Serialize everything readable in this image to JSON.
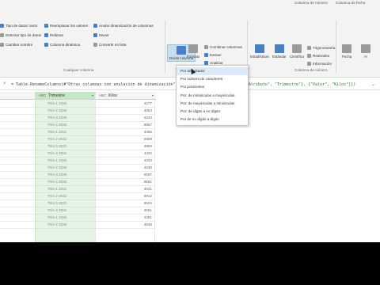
{
  "ribbon": {
    "group_titles": [
      "Columna de número",
      "Columna de fecha"
    ],
    "left_items": [
      {
        "label": "Tipo de datos: texto",
        "icon": "data-type-icon"
      },
      {
        "label": "Detectar tipo de datos",
        "icon": "detect-type-icon"
      },
      {
        "label": "Cambiar nombre",
        "icon": "rename-icon"
      }
    ],
    "mid_items": [
      {
        "label": "Reemplazar los valores",
        "icon": "replace-values-icon"
      },
      {
        "label": "Rellenar",
        "icon": "fill-icon"
      },
      {
        "label": "Columna dinámica",
        "icon": "pivot-column-icon"
      }
    ],
    "right_items": [
      {
        "label": "Anular dinamización de columnas",
        "icon": "unpivot-icon"
      },
      {
        "label": "Mover",
        "icon": "move-icon"
      },
      {
        "label": "Convertir en lista",
        "icon": "convert-list-icon"
      }
    ],
    "big_buttons": [
      {
        "label": "Dividir columna",
        "icon": "split-column-icon"
      },
      {
        "label": "Formato",
        "icon": "format-icon"
      }
    ],
    "text_col_items": [
      {
        "label": "Combinar columnas",
        "icon": "merge-columns-icon"
      },
      {
        "label": "Extraer",
        "icon": "extract-icon"
      },
      {
        "label": "Analizar",
        "icon": "parse-icon"
      }
    ],
    "num_buttons": [
      {
        "label": "Estadísticas",
        "icon": "statistics-icon"
      },
      {
        "label": "Estándar",
        "icon": "standard-icon"
      },
      {
        "label": "Científico",
        "icon": "scientific-icon"
      }
    ],
    "trig_items": [
      {
        "label": "Trigonometría",
        "icon": "trig-icon"
      },
      {
        "label": "Redondeo",
        "icon": "rounding-icon"
      },
      {
        "label": "Información",
        "icon": "info-icon"
      }
    ],
    "date_buttons": [
      {
        "label": "Fecha",
        "icon": "date-icon"
      },
      {
        "label": "H",
        "icon": "time-icon"
      }
    ],
    "group_labels": {
      "any_column": "Cualquier columna",
      "number_column": "Columna de número"
    }
  },
  "formula": {
    "prefix": "= Table.RenameColumns(#\"Otras columnas con anulación de dinamización\",",
    "suffix": "\"Atributo\", \"Trimestre\"}, {\"Valor\", \"Kilos\"}})"
  },
  "table": {
    "columns": [
      {
        "type": "ABC",
        "name": "Trimestre"
      },
      {
        "type": "ABC",
        "name": "Kilos"
      }
    ],
    "rows": [
      {
        "trimestre": "Trim 1 2020",
        "kilos": "4277"
      },
      {
        "trimestre": "Trim 2 2020",
        "kilos": "3054"
      },
      {
        "trimestre": "Trim 3 2020",
        "kilos": "4234"
      },
      {
        "trimestre": "Trim 4 2020",
        "kilos": "6067"
      },
      {
        "trimestre": "Trim 1 2021",
        "kilos": "4466"
      },
      {
        "trimestre": "Trim 2 2021",
        "kilos": "2809"
      },
      {
        "trimestre": "Trim 3 2021",
        "kilos": "4853"
      },
      {
        "trimestre": "Trim 4 2021",
        "kilos": "4432"
      },
      {
        "trimestre": "Trim 1 2020",
        "kilos": "4333"
      },
      {
        "trimestre": "Trim 2 2020",
        "kilos": "3330"
      },
      {
        "trimestre": "Trim 3 2020",
        "kilos": "5597"
      },
      {
        "trimestre": "Trim 4 2020",
        "kilos": "6561"
      },
      {
        "trimestre": "Trim 1 2021",
        "kilos": "4021"
      },
      {
        "trimestre": "Trim 2 2021",
        "kilos": "5912"
      },
      {
        "trimestre": "Trim 3 2021",
        "kilos": "6534"
      },
      {
        "trimestre": "Trim 4 2021",
        "kilos": "3551"
      },
      {
        "trimestre": "Trim 1 2020",
        "kilos": "3351"
      },
      {
        "trimestre": "Trim 2 2020",
        "kilos": "3538"
      }
    ]
  },
  "dropdown": {
    "items": [
      "Por delimitador",
      "Por número de caracteres",
      "Por posiciones",
      "Por: de minúsculas a mayúsculas",
      "Por: de mayúsculas a minúsculas",
      "Por: de dígito a no dígito",
      "Por de no dígito a dígito"
    ],
    "hovered_index": 0
  },
  "colors": {
    "accent": "#4a7fc1",
    "selected_column": "#e4f3e4",
    "selected_header": "#c6e6c6",
    "menu_hover": "#dce9f7"
  }
}
